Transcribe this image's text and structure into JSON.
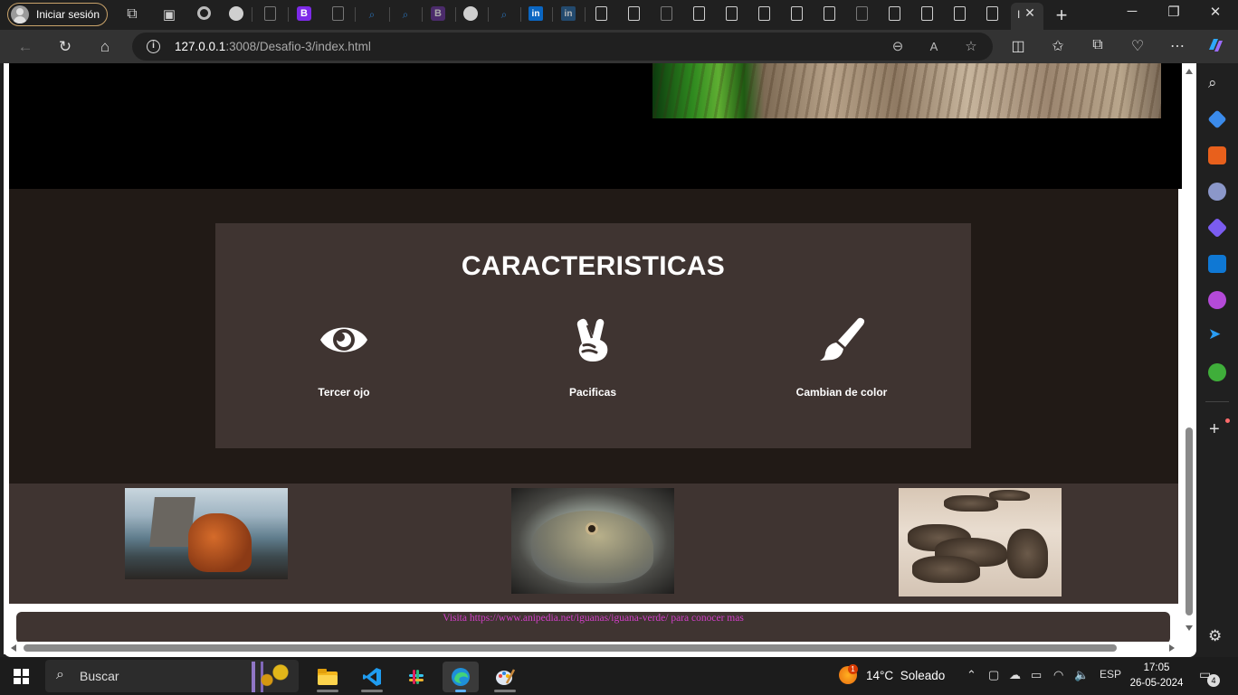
{
  "browser": {
    "profile_label": "Iniciar sesión",
    "url_host": "127.0.0.1",
    "url_rest": ":3008/Desafio-3/index.html",
    "active_tab_label": "I",
    "b_tab_label": "B",
    "b_tab_label_2": "B",
    "linkedin_label": "in"
  },
  "page": {
    "features_title": "CARACTERISTICAS",
    "features": [
      {
        "label": "Tercer ojo",
        "icon": "eye-icon"
      },
      {
        "label": "Pacificas",
        "icon": "peace-hand-icon"
      },
      {
        "label": "Cambian de color",
        "icon": "paintbrush-icon"
      }
    ],
    "footer_text": "Visita https://www.anipedia.net/iguanas/iguana-verde/ para conocer mas"
  },
  "taskbar": {
    "search_label": "Buscar",
    "weather_temp": "14°C",
    "weather_desc": "Soleado",
    "weather_badge": "1",
    "language": "ESP",
    "time": "17:05",
    "date": "26-05-2024",
    "notifications": "4"
  },
  "colors": {
    "features_bg": "#211a16",
    "card_bg": "#3f3431",
    "footer_text": "#d33fc9",
    "accent": "#5cb1ff"
  }
}
